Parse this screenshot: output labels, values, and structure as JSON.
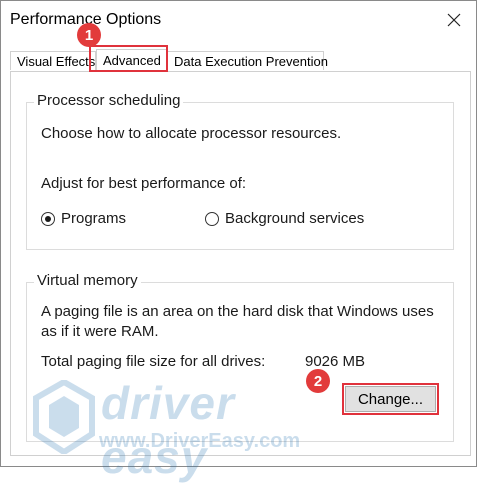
{
  "window": {
    "title": "Performance Options"
  },
  "tabs": [
    {
      "label": "Visual Effects"
    },
    {
      "label": "Advanced"
    },
    {
      "label": "Data Execution Prevention"
    }
  ],
  "processor": {
    "group_label": "Processor scheduling",
    "description": "Choose how to allocate processor resources.",
    "adjust_label": "Adjust for best performance of:",
    "options": [
      {
        "label": "Programs",
        "selected": true
      },
      {
        "label": "Background services",
        "selected": false
      }
    ]
  },
  "virtual_memory": {
    "group_label": "Virtual memory",
    "description_line1": "A paging file is an area on the hard disk that Windows uses",
    "description_line2": "as if it were RAM.",
    "total_label": "Total paging file size for all drives:",
    "total_value": "9026 MB",
    "change_button": "Change..."
  },
  "annotations": {
    "step1": "1",
    "step2": "2",
    "highlight_color": "#e0323c"
  },
  "watermark": {
    "brand": "driver easy",
    "url": "www.DriverEasy.com"
  }
}
